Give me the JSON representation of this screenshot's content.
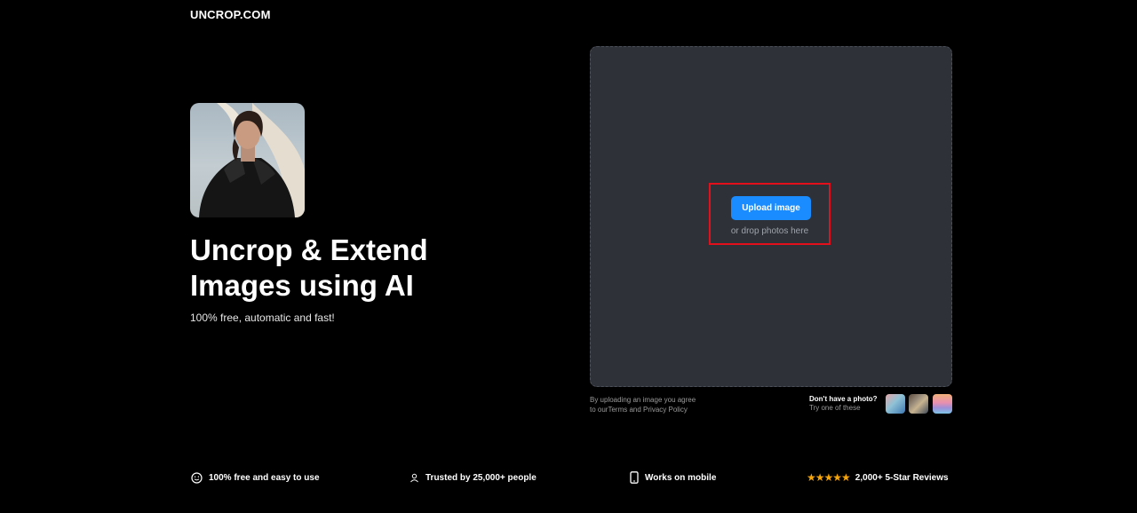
{
  "header": {
    "logo_text": "UNCROP.COM"
  },
  "hero": {
    "title_line1": "Uncrop & Extend",
    "title_line2": "Images using AI",
    "subtitle": "100% free, automatic and fast!"
  },
  "upload": {
    "button_label": "Upload image",
    "drop_hint": "or drop photos here",
    "terms_line1": "By uploading an image you agree",
    "terms_prefix": "to our",
    "terms_link": "Terms and Privacy Policy"
  },
  "samples": {
    "title": "Don't have a photo?",
    "subtitle": "Try one of these"
  },
  "features": [
    {
      "icon": "smiley-icon",
      "label": "100% free and easy to use"
    },
    {
      "icon": "user-icon",
      "label": "Trusted by 25,000+ people"
    },
    {
      "icon": "phone-icon",
      "label": "Works on mobile"
    },
    {
      "icon": "stars-icon",
      "label": "2,000+ 5-Star Reviews",
      "stars": "★★★★★"
    }
  ],
  "colors": {
    "background": "#000000",
    "panel": "#2e3138",
    "accent": "#1a8cff",
    "highlight": "#e3101c",
    "star": "#f6a609"
  }
}
